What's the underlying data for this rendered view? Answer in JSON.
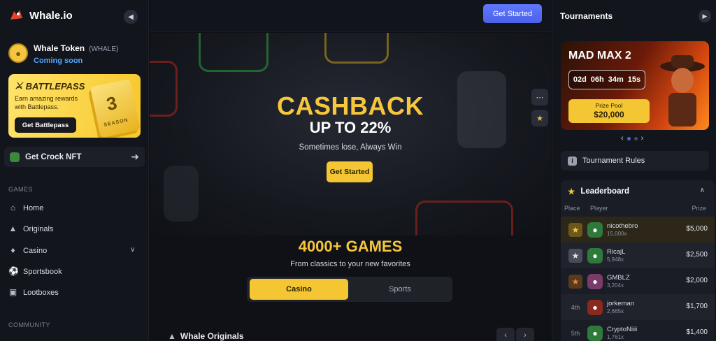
{
  "app": {
    "name": "Whale.io"
  },
  "sidebar": {
    "token": {
      "name": "Whale Token",
      "symbol": "(WHALE)",
      "status": "Coming soon"
    },
    "battlepass": {
      "title": "BATTLEPASS",
      "desc": "Earn amazing rewards with Battlepass.",
      "button": "Get Battlepass",
      "card_number": "3",
      "card_label": "SEASON"
    },
    "nft": {
      "label": "Get Crock NFT"
    },
    "games_label": "GAMES",
    "nav": [
      {
        "label": "Home",
        "icon": "home-icon"
      },
      {
        "label": "Originals",
        "icon": "originals-icon"
      },
      {
        "label": "Casino",
        "icon": "casino-icon"
      },
      {
        "label": "Sportsbook",
        "icon": "sportsbook-icon"
      },
      {
        "label": "Lootboxes",
        "icon": "lootbox-icon"
      }
    ],
    "community_label": "COMMUNITY"
  },
  "header": {
    "cta": "Get Started"
  },
  "hero": {
    "headline": "CASHBACK",
    "subheadline": "UP TO 22%",
    "tagline": "Sometimes lose, Always Win",
    "button": "Get Started"
  },
  "games": {
    "title": "4000+ GAMES",
    "subtitle": "From classics to your new favorites",
    "tabs": [
      {
        "label": "Casino",
        "active": true
      },
      {
        "label": "Sports",
        "active": false
      }
    ],
    "section_title": "Whale Originals"
  },
  "tournaments": {
    "title": "Tournaments",
    "current": {
      "name": "MAD MAX 2",
      "timer": {
        "days": "02d",
        "hours": "06h",
        "minutes": "34m",
        "seconds": "15s"
      },
      "prize_label": "Prize Pool",
      "prize_value": "$20,000"
    },
    "slides": 2,
    "active_slide": 1,
    "rules_label": "Tournament Rules",
    "leaderboard": {
      "title": "Leaderboard",
      "columns": {
        "place": "Place",
        "player": "Player",
        "prize": "Prize"
      },
      "rows": [
        {
          "place": "",
          "player": "nicothebro",
          "mult": "15,000x",
          "prize": "$5,000",
          "trophy": "gold"
        },
        {
          "place": "",
          "player": "RicajL",
          "mult": "5,948x",
          "prize": "$2,500",
          "trophy": "silver"
        },
        {
          "place": "",
          "player": "GMBLZ",
          "mult": "3,204x",
          "prize": "$2,000",
          "trophy": "bronze"
        },
        {
          "place": "4th",
          "player": "jorkeman",
          "mult": "2,665x",
          "prize": "$1,700",
          "trophy": ""
        },
        {
          "place": "5th",
          "player": "CryptoNiiii",
          "mult": "1,761x",
          "prize": "$1,400",
          "trophy": ""
        }
      ]
    }
  },
  "colors": {
    "accent_yellow": "#f5c634",
    "accent_blue": "#4b62e9",
    "background": "#0f1117"
  }
}
